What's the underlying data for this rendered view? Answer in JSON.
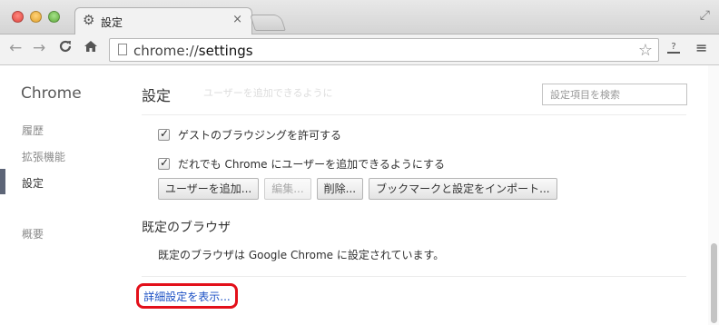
{
  "window": {
    "tab_title": "設定",
    "tab_close": "×",
    "tab_icon": "gear-icon",
    "fullscreen_glyph": "⤢"
  },
  "toolbar": {
    "back_glyph": "←",
    "forward_glyph": "→",
    "reload_glyph": "C",
    "home_glyph": "⌂",
    "url_scheme": "chrome://",
    "url_path": "settings",
    "star_glyph": "☆",
    "help_glyph": "?",
    "menu_glyph": "≡"
  },
  "sidebar": {
    "brand": "Chrome",
    "items": [
      {
        "label": "履歴",
        "active": false
      },
      {
        "label": "拡張機能",
        "active": false
      },
      {
        "label": "設定",
        "active": true
      },
      {
        "label": "概要",
        "active": false
      }
    ]
  },
  "main": {
    "title": "設定",
    "faded_heading": "ユーザーを追加できるように",
    "search_placeholder": "設定項目を検索",
    "checkboxes": [
      {
        "label": "ゲストのブラウジングを許可する",
        "checked": true
      },
      {
        "label": "だれでも Chrome にユーザーを追加できるようにする",
        "checked": true
      }
    ],
    "buttons": [
      {
        "label": "ユーザーを追加...",
        "disabled": false
      },
      {
        "label": "編集...",
        "disabled": true
      },
      {
        "label": "削除...",
        "disabled": false
      },
      {
        "label": "ブックマークと設定をインポート...",
        "disabled": false
      }
    ],
    "default_browser_heading": "既定のブラウザ",
    "default_browser_text": "既定のブラウザは Google Chrome に設定されています。",
    "advanced_link": "詳細設定を表示..."
  },
  "colors": {
    "highlight_border": "#e3101a",
    "link": "#1a4fc4",
    "active_bar": "#5d6577"
  }
}
